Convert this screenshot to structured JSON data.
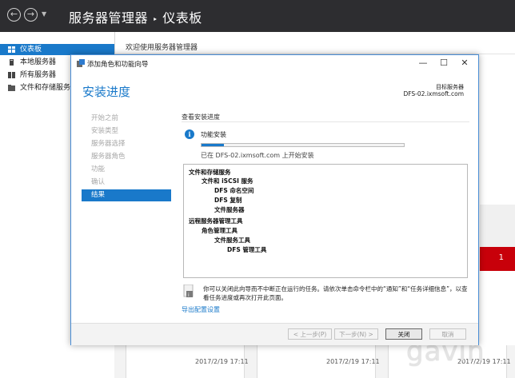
{
  "server_manager": {
    "title": "服务器管理器",
    "title_sep": "‣",
    "breadcrumb": "仪表板",
    "sidebar": [
      {
        "label": "仪表板",
        "icon": "dashboard-icon",
        "selected": true
      },
      {
        "label": "本地服务器",
        "icon": "server-icon",
        "selected": false
      },
      {
        "label": "所有服务器",
        "icon": "servers-icon",
        "selected": false
      },
      {
        "label": "文件和存储服务",
        "icon": "file-storage-icon",
        "selected": false
      }
    ],
    "welcome": "欢迎使用服务器管理器",
    "red_tile_count": "1",
    "tile_dates": [
      "2017/2/19 17:11",
      "2017/2/19 17:11",
      "2017/2/19 17:11"
    ],
    "watermark": "gavin",
    "colors": {
      "titlebar": "#2d2d30",
      "accent": "#1979ca",
      "alert": "#c8000a"
    }
  },
  "wizard": {
    "window_title": "添加角色和功能向导",
    "controls": {
      "minimize": "—",
      "maximize": "☐",
      "close": "✕"
    },
    "heading": "安装进度",
    "target_label": "目标服务器",
    "target_server": "DFS-02.ixmsoft.com",
    "steps": [
      {
        "label": "开始之前",
        "active": false
      },
      {
        "label": "安装类型",
        "active": false
      },
      {
        "label": "服务器选择",
        "active": false
      },
      {
        "label": "服务器角色",
        "active": false
      },
      {
        "label": "功能",
        "active": false
      },
      {
        "label": "确认",
        "active": false
      },
      {
        "label": "结果",
        "active": true
      }
    ],
    "section_title": "查看安装进度",
    "info_icon": "i",
    "feature_label": "功能安装",
    "progress": 0.11,
    "status_text": "已在 DFS-02.ixmsoft.com 上开始安装",
    "items": [
      {
        "label": "文件和存储服务",
        "level": 0
      },
      {
        "label": "文件和 iSCSI 服务",
        "level": 1
      },
      {
        "label": "DFS 命名空间",
        "level": 2
      },
      {
        "label": "DFS 复制",
        "level": 2
      },
      {
        "label": "文件服务器",
        "level": 2
      },
      {
        "label": "远程服务器管理工具",
        "level": 0
      },
      {
        "label": "角色管理工具",
        "level": 1
      },
      {
        "label": "文件服务工具",
        "level": 2
      },
      {
        "label": "DFS 管理工具",
        "level": 3
      }
    ],
    "note": "你可以关闭此向导而不中断正在运行的任务。请依次单击命令栏中的“通知”和“任务详细信息”，以查看任务进度或再次打开此页面。",
    "export_link": "导出配置设置",
    "buttons": {
      "previous": "< 上一步(P)",
      "next": "下一步(N) >",
      "close": "关闭",
      "cancel": "取消"
    }
  }
}
